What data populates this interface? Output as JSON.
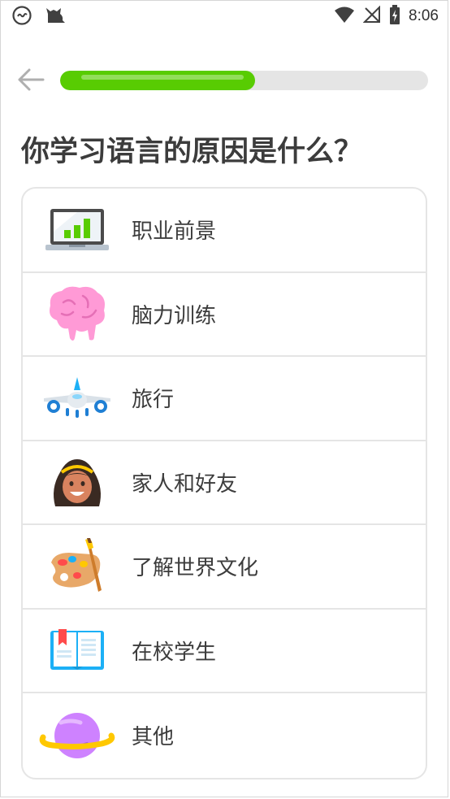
{
  "status_bar": {
    "time": "8:06",
    "icons": [
      "app-notification-icon",
      "cat-notification-icon",
      "wifi-icon",
      "no-signal-icon",
      "battery-charging-icon"
    ]
  },
  "header": {
    "back_icon": "arrow-left-icon",
    "progress_fraction": 0.53
  },
  "question": "你学习语言的原因是什么？",
  "options": [
    {
      "label": "职业前景",
      "icon": "laptop-chart-icon"
    },
    {
      "label": "脑力训练",
      "icon": "brain-icon"
    },
    {
      "label": "旅行",
      "icon": "airplane-icon"
    },
    {
      "label": "家人和好友",
      "icon": "person-icon"
    },
    {
      "label": "了解世界文化",
      "icon": "paint-palette-icon"
    },
    {
      "label": "在校学生",
      "icon": "open-book-icon"
    },
    {
      "label": "其他",
      "icon": "planet-icon"
    }
  ],
  "colors": {
    "progress": "#58cc02",
    "track": "#e5e5e5",
    "border": "#e5e5e5",
    "text": "#3c3c3c"
  }
}
